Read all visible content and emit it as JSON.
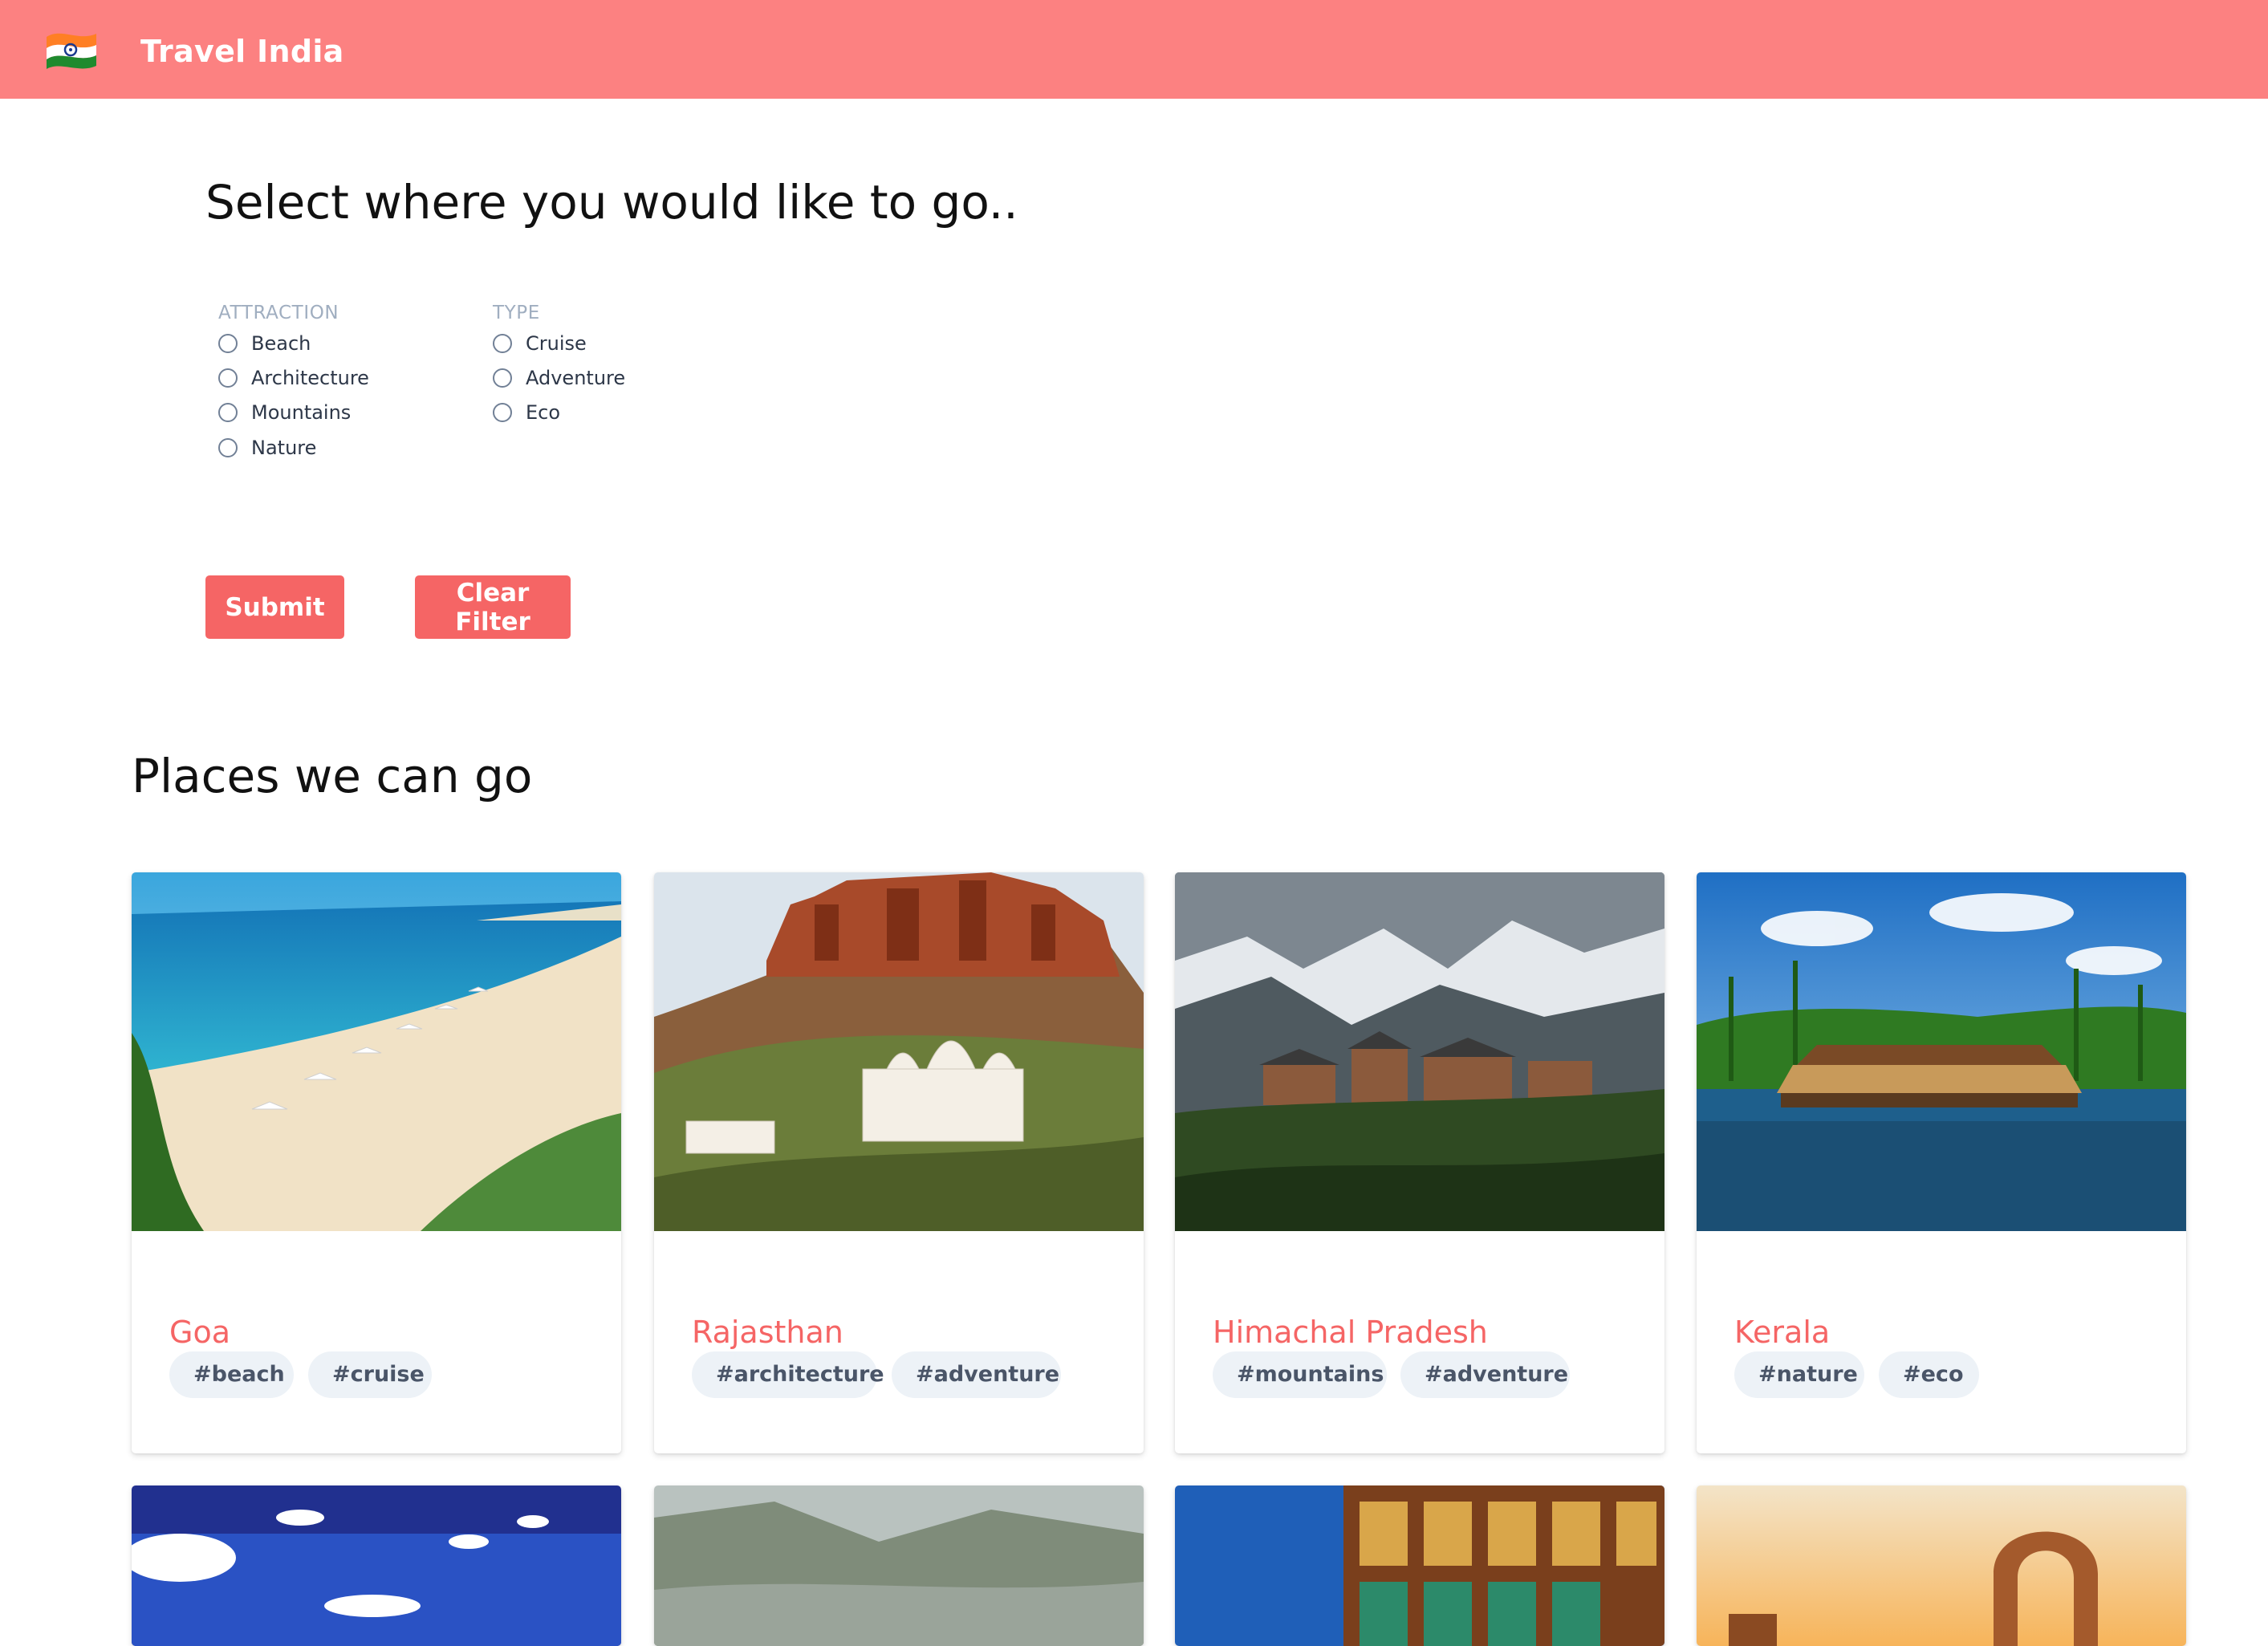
{
  "header": {
    "brand": "Travel India",
    "logo_icon": "india-flag-icon",
    "background": "#fc8181"
  },
  "filters": {
    "title": "Select where you would like to go..",
    "attraction": {
      "label": "ATTRACTION",
      "options": [
        "Beach",
        "Architecture",
        "Mountains",
        "Nature"
      ]
    },
    "type": {
      "label": "TYPE",
      "options": [
        "Cruise",
        "Adventure",
        "Eco"
      ]
    },
    "submit_label": "Submit",
    "clear_label": "Clear Filter",
    "button_color": "#f56565"
  },
  "places": {
    "title": "Places we can go",
    "items": [
      {
        "name": "Goa",
        "tags": [
          "#beach",
          "#cruise"
        ],
        "image": "beach-photo"
      },
      {
        "name": "Rajasthan",
        "tags": [
          "#architecture",
          "#adventure"
        ],
        "image": "fort-photo"
      },
      {
        "name": "Himachal Pradesh",
        "tags": [
          "#mountains",
          "#adventure"
        ],
        "image": "mountain-village-photo"
      },
      {
        "name": "Kerala",
        "tags": [
          "#nature",
          "#eco"
        ],
        "image": "houseboat-photo"
      }
    ],
    "partial_images": [
      "sky-photo",
      "valley-photo",
      "temple-photo",
      "ruins-photo"
    ]
  }
}
